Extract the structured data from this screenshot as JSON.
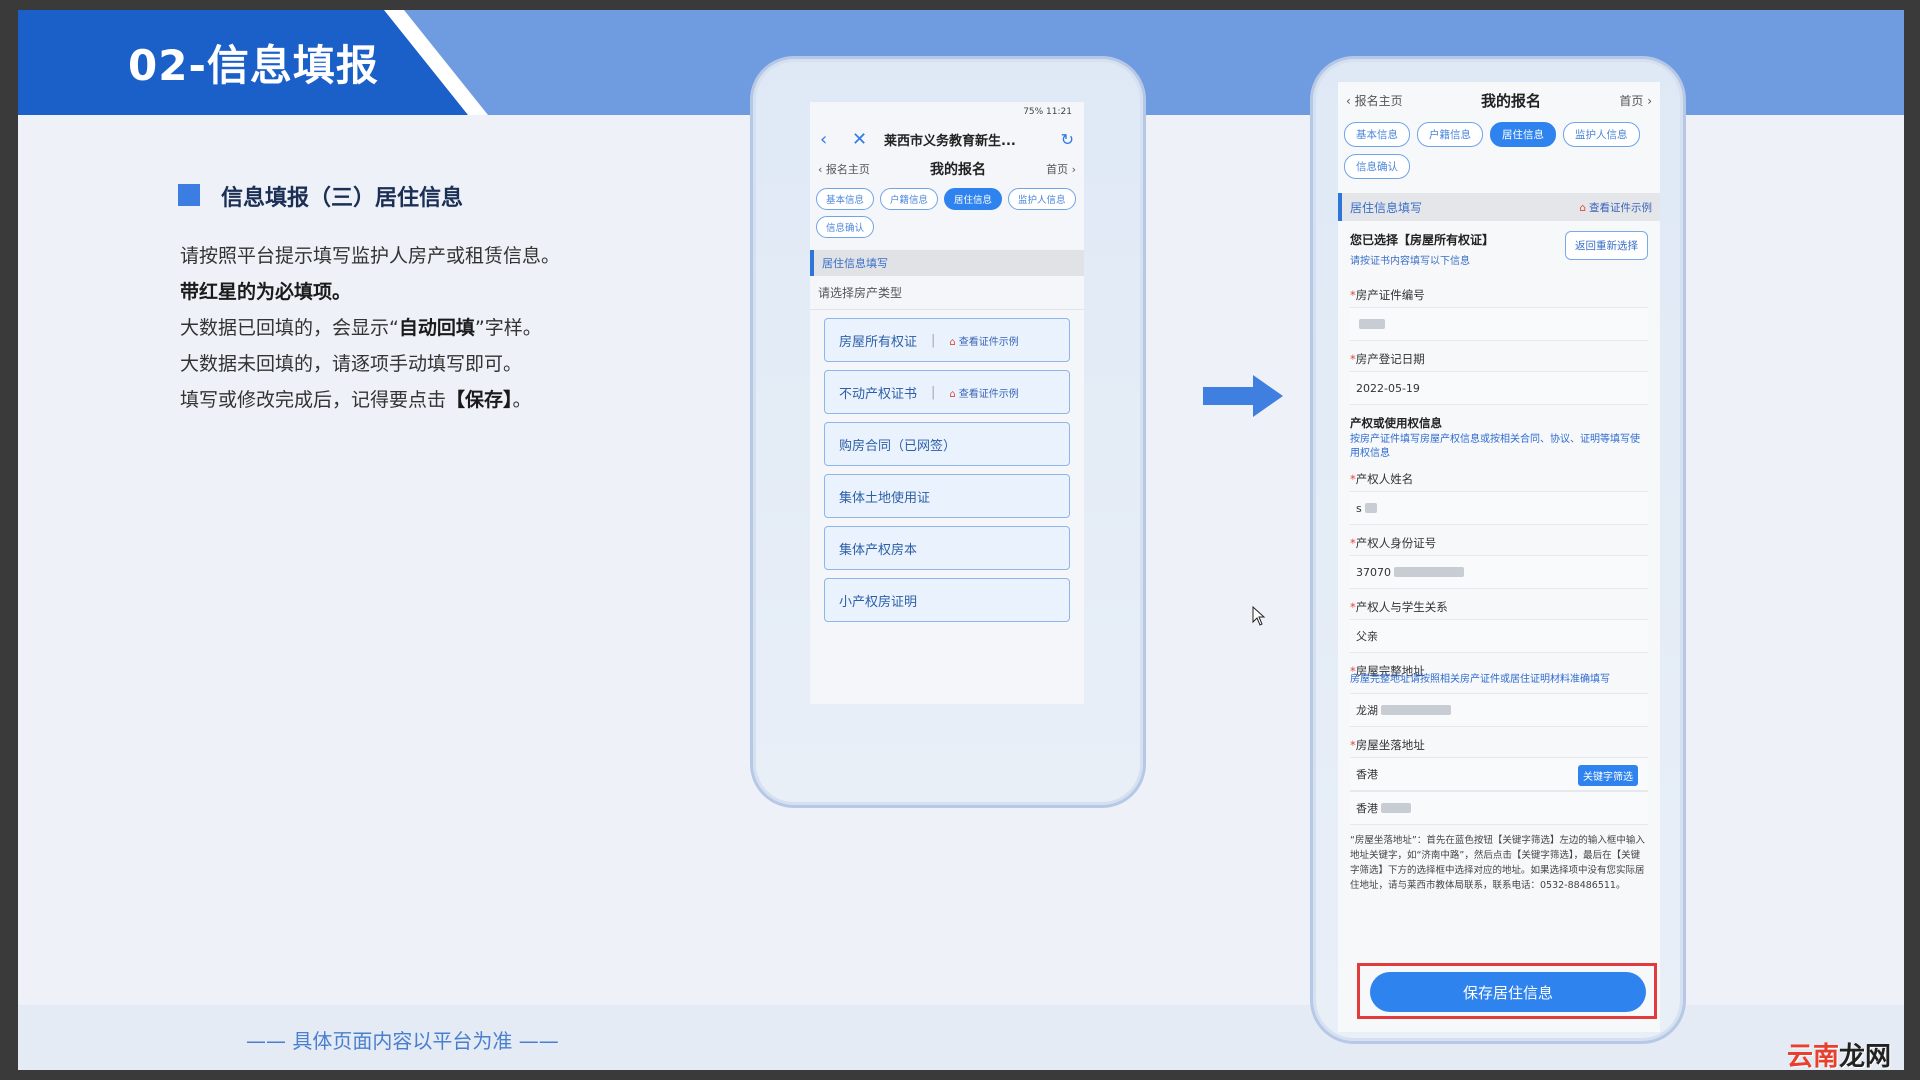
{
  "header": {
    "title": "02-信息填报"
  },
  "section": {
    "title": "信息填报（三）居住信息",
    "line1": "请按照平台提示填写监护人房产或租赁信息。",
    "line2": "带红星的为必填项。",
    "line3_pre": "大数据已回填的，会显示“",
    "line3_bold": "自动回填",
    "line3_post": "”字样。",
    "line4": "大数据未回填的，请逐项手动填写即可。",
    "line5_pre": "填写或修改完成后，记得要点击",
    "line5_bold": "【保存】",
    "line5_post": "。"
  },
  "footer": {
    "note": "—— 具体页面内容以平台为准 ——"
  },
  "phone1": {
    "status": "75%  11:21",
    "browser_title": "莱西市义务教育新生...",
    "nav_back": "报名主页",
    "nav_title": "我的报名",
    "nav_home": "首页",
    "tabs": [
      "基本信息",
      "户籍信息",
      "居住信息",
      "监护人信息",
      "信息确认"
    ],
    "section_head": "居住信息填写",
    "sub_label": "请选择房产类型",
    "view_example": "查看证件示例",
    "options": [
      "房屋所有权证",
      "不动产权证书",
      "购房合同（已网签）",
      "集体土地使用证",
      "集体产权房本",
      "小产权房证明"
    ]
  },
  "phone2": {
    "nav_back": "报名主页",
    "nav_title": "我的报名",
    "nav_home": "首页",
    "tabs": [
      "基本信息",
      "户籍信息",
      "居住信息",
      "监护人信息",
      "信息确认"
    ],
    "section_head": "居住信息填写",
    "view_example": "查看证件示例",
    "chosen_title": "您已选择【房屋所有权证】",
    "chosen_sub": "请按证书内容填写以下信息",
    "reselect": "返回重新选择",
    "cert_no_label": "房产证件编号",
    "reg_date_label": "房产登记日期",
    "reg_date_value": "2022-05-19",
    "rights_title": "产权或使用权信息",
    "rights_hint": "按房产证件填写房屋产权信息或按相关合同、协议、证明等填写使用权信息",
    "owner_name_label": "产权人姓名",
    "owner_name_prefix": "s",
    "owner_id_label": "产权人身份证号",
    "owner_id_prefix": "37070",
    "relation_label": "产权人与学生关系",
    "relation_value": "父亲",
    "full_addr_label": "房屋完整地址",
    "full_addr_hint": "房屋完整地址请按照相关房产证件或居住证明材料准确填写",
    "full_addr_prefix": "龙湖",
    "location_label": "房屋坐落地址",
    "location_value1": "香港",
    "keyword_btn": "关键字筛选",
    "location_value2": "香港",
    "note": "“房屋坐落地址”：首先在蓝色按钮【关键字筛选】左边的输入框中输入地址关键字，如“济南中路”，然后点击【关键字筛选】，最后在【关键字筛选】下方的选择框中选择对应的地址。如果选择项中没有您实际居住地址，请与莱西市教体局联系，联系电话：0532-88486511。",
    "save_btn": "保存居住信息"
  },
  "watermark": {
    "part1": "云南",
    "part2": "龙网"
  },
  "colors": {
    "brand_dark": "#1b5fc8",
    "brand_light": "#6f9be0",
    "accent": "#2e83ee",
    "highlight": "#e23b3b"
  }
}
